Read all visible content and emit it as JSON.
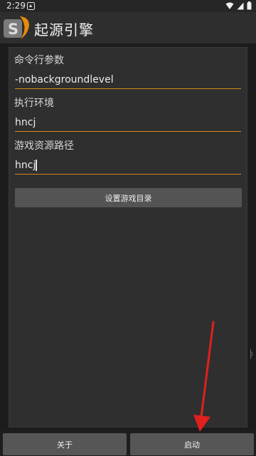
{
  "status_bar": {
    "time": "2:29"
  },
  "app_bar": {
    "title": "起源引擎",
    "logo_icon": "source-engine-logo-icon"
  },
  "form": {
    "fields": [
      {
        "label": "命令行参数",
        "value": "-nobackgroundlevel"
      },
      {
        "label": "执行环境",
        "value": "hncj"
      },
      {
        "label": "游戏资源路径",
        "value": "hncj"
      }
    ],
    "set_dir_button": "设置游戏目录"
  },
  "bottom_bar": {
    "about_button": "关于",
    "start_button": "启动"
  },
  "colors": {
    "accent_underline": "#d58a16",
    "annotation_arrow": "#e0201c"
  }
}
